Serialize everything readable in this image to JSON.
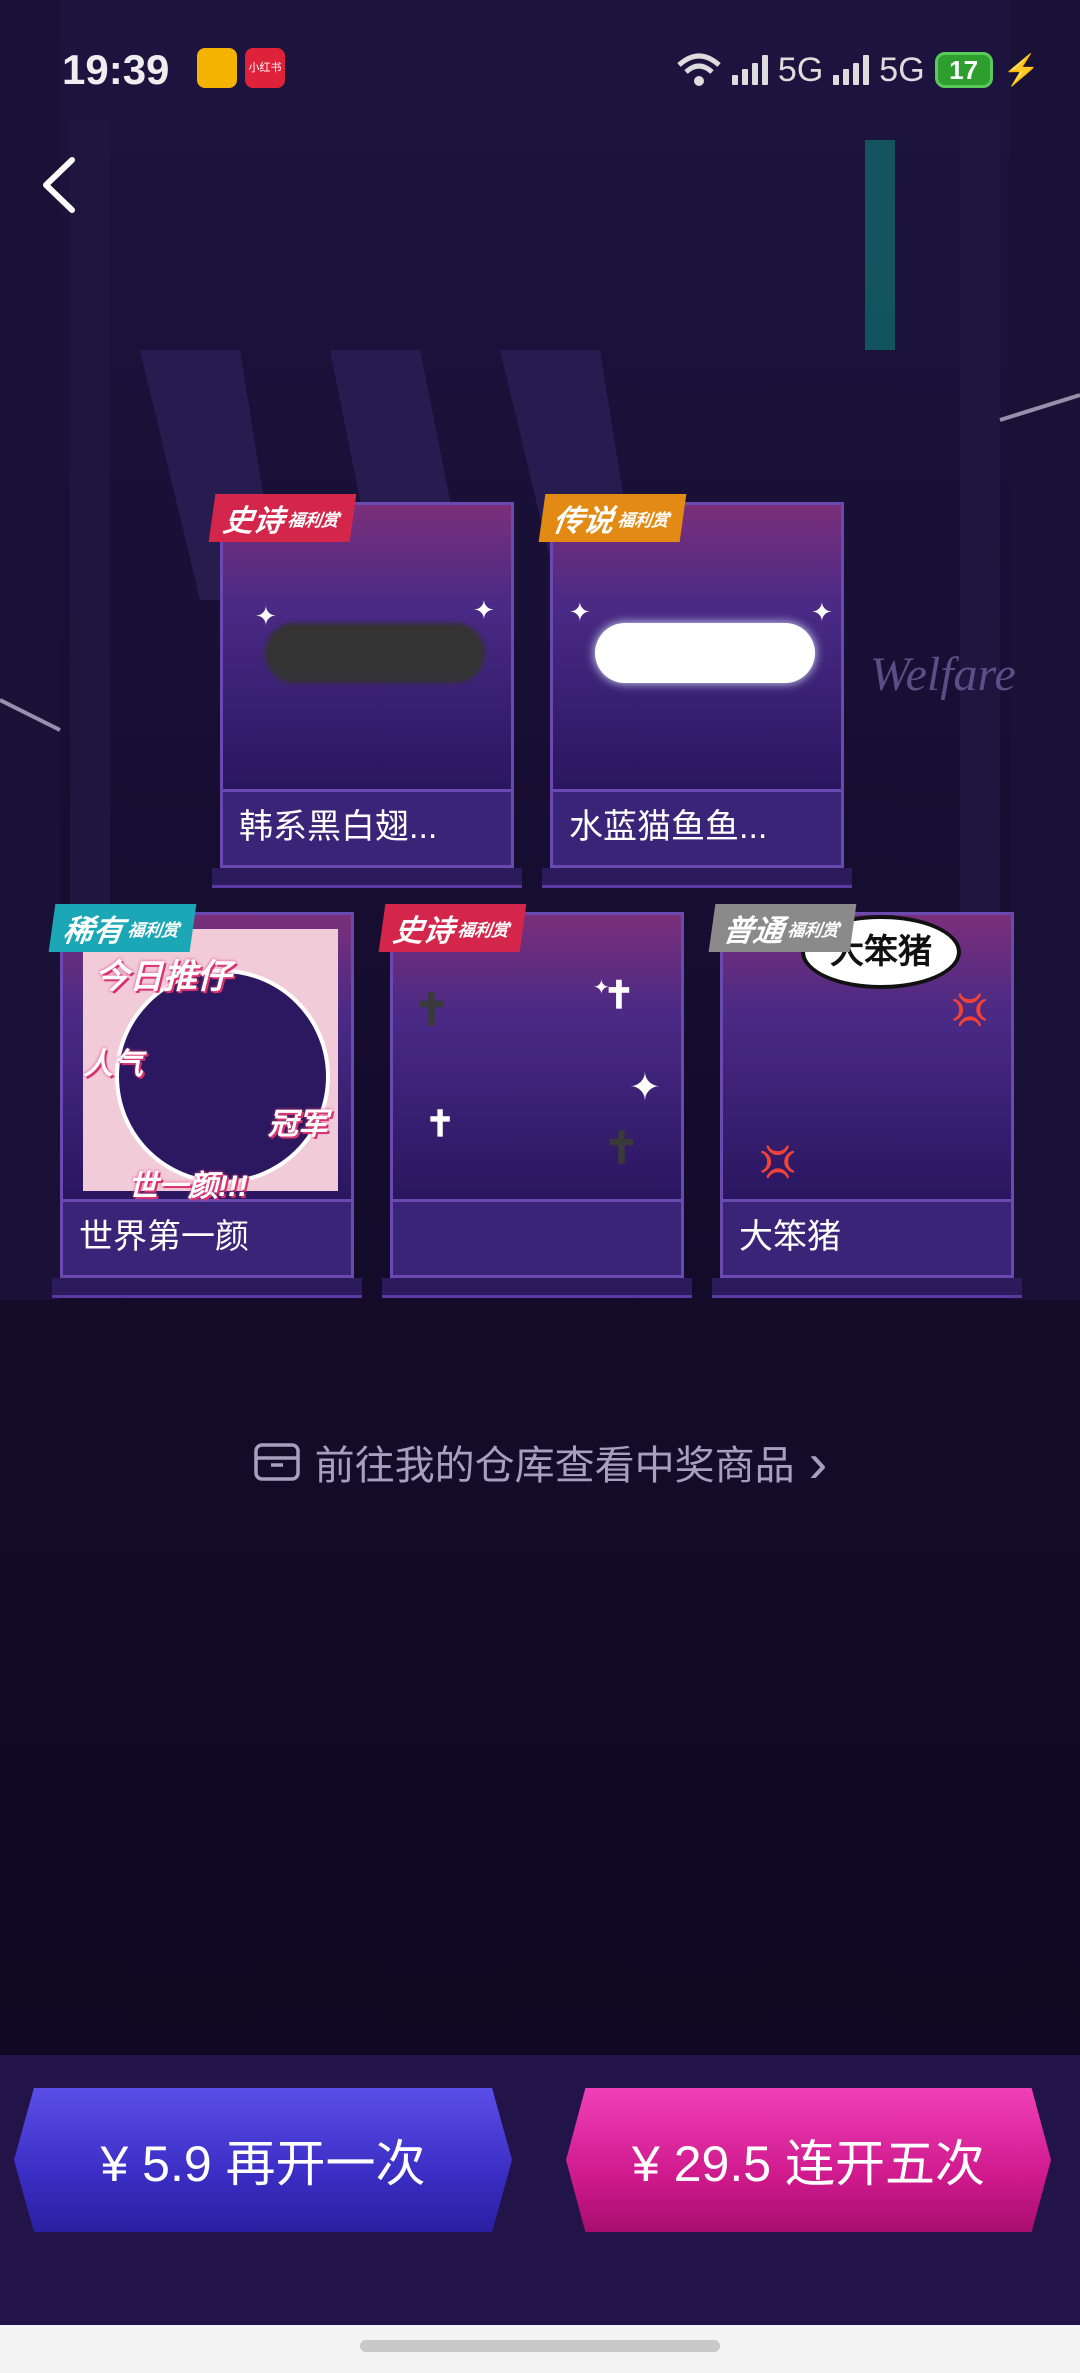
{
  "status_bar": {
    "time": "19:39",
    "network_1": "5G",
    "network_2": "5G",
    "battery": "17",
    "apps": [
      "weibo-icon",
      "xiaohongshu-icon"
    ],
    "xhs_text": "小红书"
  },
  "nav": {
    "back_icon": "chevron-left-icon"
  },
  "cards": [
    {
      "tag_main": "史诗",
      "tag_sub": "福利赏",
      "name": "韩系黑白翅...",
      "tag_color": "#d3264a"
    },
    {
      "tag_main": "传说",
      "tag_sub": "福利赏",
      "name": "水蓝猫鱼鱼...",
      "tag_color": "#e28a14"
    },
    {
      "tag_main": "稀有",
      "tag_sub": "福利赏",
      "name": "世界第一颜",
      "tag_color": "#1ba7b6",
      "frame_words": [
        "今日推仔",
        "人气",
        "冠军",
        "世一颜!!!"
      ]
    },
    {
      "tag_main": "史诗",
      "tag_sub": "福利赏",
      "name": "",
      "tag_color": "#d3264a"
    },
    {
      "tag_main": "普通",
      "tag_sub": "福利赏",
      "name": "大笨猪",
      "tag_color": "#8a8a8a",
      "bubble_text": "大笨猪"
    }
  ],
  "background_text": "Welfare",
  "warehouse_link": {
    "text": "前往我的仓库查看中奖商品",
    "icon": "box-icon",
    "arrow": "›"
  },
  "actions": {
    "single": {
      "label": "¥ 5.9 再开一次"
    },
    "five": {
      "label": "¥ 29.5 连开五次"
    }
  }
}
